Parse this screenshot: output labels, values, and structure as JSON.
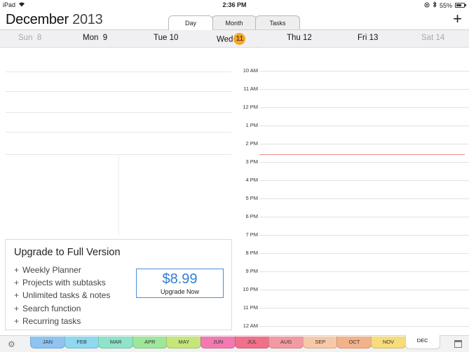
{
  "status_bar": {
    "device": "iPad",
    "time": "2:36 PM",
    "battery": "55%",
    "battery_level": 0.55
  },
  "header": {
    "month": "December",
    "year": "2013",
    "add_label": "+"
  },
  "view_tabs": [
    {
      "label": "Day",
      "active": true
    },
    {
      "label": "Month",
      "active": false
    },
    {
      "label": "Tasks",
      "active": false
    }
  ],
  "week": [
    {
      "name": "Sun",
      "num": "8",
      "muted": true
    },
    {
      "name": "Mon",
      "num": "9",
      "muted": false
    },
    {
      "name": "Tue",
      "num": "10",
      "muted": false
    },
    {
      "name": "Wed",
      "num": "11",
      "muted": false,
      "today": true
    },
    {
      "name": "Thu",
      "num": "12",
      "muted": false
    },
    {
      "name": "Fri",
      "num": "13",
      "muted": false
    },
    {
      "name": "Sat",
      "num": "14",
      "muted": true
    }
  ],
  "upgrade": {
    "title": "Upgrade to Full Version",
    "features": [
      "Weekly Planner",
      "Projects with subtasks",
      "Unlimited tasks & notes",
      "Search function",
      "Recurring tasks"
    ],
    "price": "$8.99",
    "button_label": "Upgrade Now"
  },
  "hours": [
    "10 AM",
    "11 AM",
    "12 PM",
    "1 PM",
    "2 PM",
    "3 PM",
    "4 PM",
    "5 PM",
    "6 PM",
    "7 PM",
    "8 PM",
    "9 PM",
    "10 PM",
    "11 PM",
    "12 AM"
  ],
  "months": [
    {
      "label": "JAN",
      "color": "#8fc3f0"
    },
    {
      "label": "FEB",
      "color": "#8ed8f0"
    },
    {
      "label": "MAR",
      "color": "#8fe3c8"
    },
    {
      "label": "APR",
      "color": "#9ee69a"
    },
    {
      "label": "MAY",
      "color": "#c4e67a"
    },
    {
      "label": "JUN",
      "color": "#f27ab0"
    },
    {
      "label": "JUL",
      "color": "#f0708a"
    },
    {
      "label": "AUG",
      "color": "#f39aa0"
    },
    {
      "label": "SEP",
      "color": "#f8c9a8"
    },
    {
      "label": "OCT",
      "color": "#f3b28a"
    },
    {
      "label": "NOV",
      "color": "#f6dc7a"
    },
    {
      "label": "DEC",
      "color": "#ffffff",
      "active": true
    }
  ],
  "colors": {
    "today_badge": "#f6a623",
    "accent_blue": "#2f7fd3",
    "now_line": "#f08a8a"
  }
}
